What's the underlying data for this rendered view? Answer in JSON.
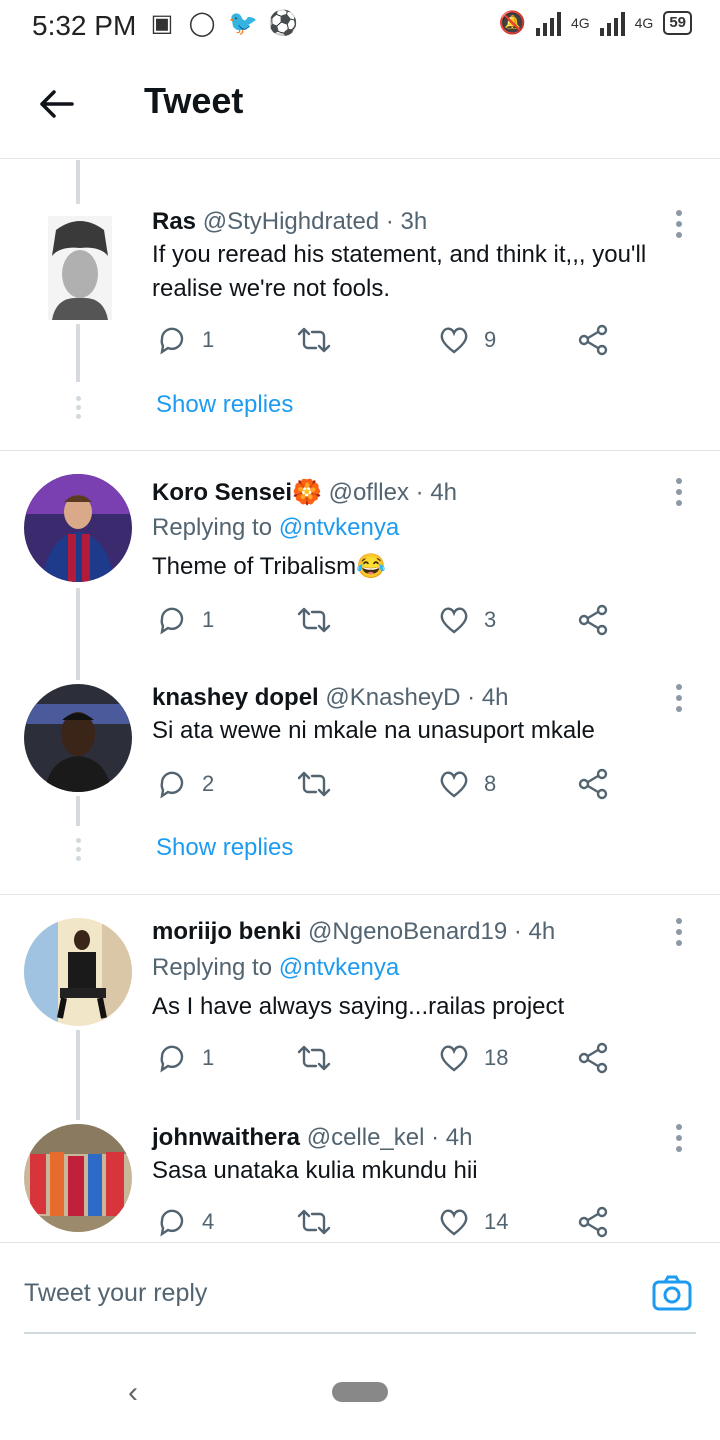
{
  "status_bar": {
    "time": "5:32 PM",
    "net1": "4G",
    "net2": "4G",
    "battery": "59"
  },
  "header": {
    "title": "Tweet"
  },
  "tweets": [
    {
      "name": "Ras",
      "meta": "@StyHighdrated · 3h",
      "text": "If you reread his statement, and think it,,, you'll realise we're not fools.",
      "replies": "1",
      "likes": "9"
    },
    {
      "name": "Koro Sensei🏵️",
      "meta": "@ofllex · 4h",
      "replying_to_prefix": "Replying to ",
      "replying_to": "@ntvkenya",
      "text": "Theme of Tribalism😂",
      "replies": "1",
      "likes": "3"
    },
    {
      "name": "knashey dopel",
      "meta": "@KnasheyD · 4h",
      "text": "Si ata wewe ni mkale na unasuport mkale",
      "replies": "2",
      "likes": "8"
    },
    {
      "name": "moriijo benki",
      "meta": "@NgenoBenard19 · 4h",
      "replying_to_prefix": "Replying to ",
      "replying_to": "@ntvkenya",
      "text": "As I have always saying...railas project",
      "replies": "1",
      "likes": "18"
    },
    {
      "name": "johnwaithera",
      "meta": "@celle_kel · 4h",
      "text": "Sasa unataka kulia mkundu hii",
      "replies": "4",
      "likes": "14"
    }
  ],
  "show_replies_label": "Show replies",
  "reply_bar": {
    "placeholder": "Tweet your reply"
  },
  "colors": {
    "link": "#1d9bf0",
    "muted": "#536471",
    "text": "#0f1419"
  }
}
